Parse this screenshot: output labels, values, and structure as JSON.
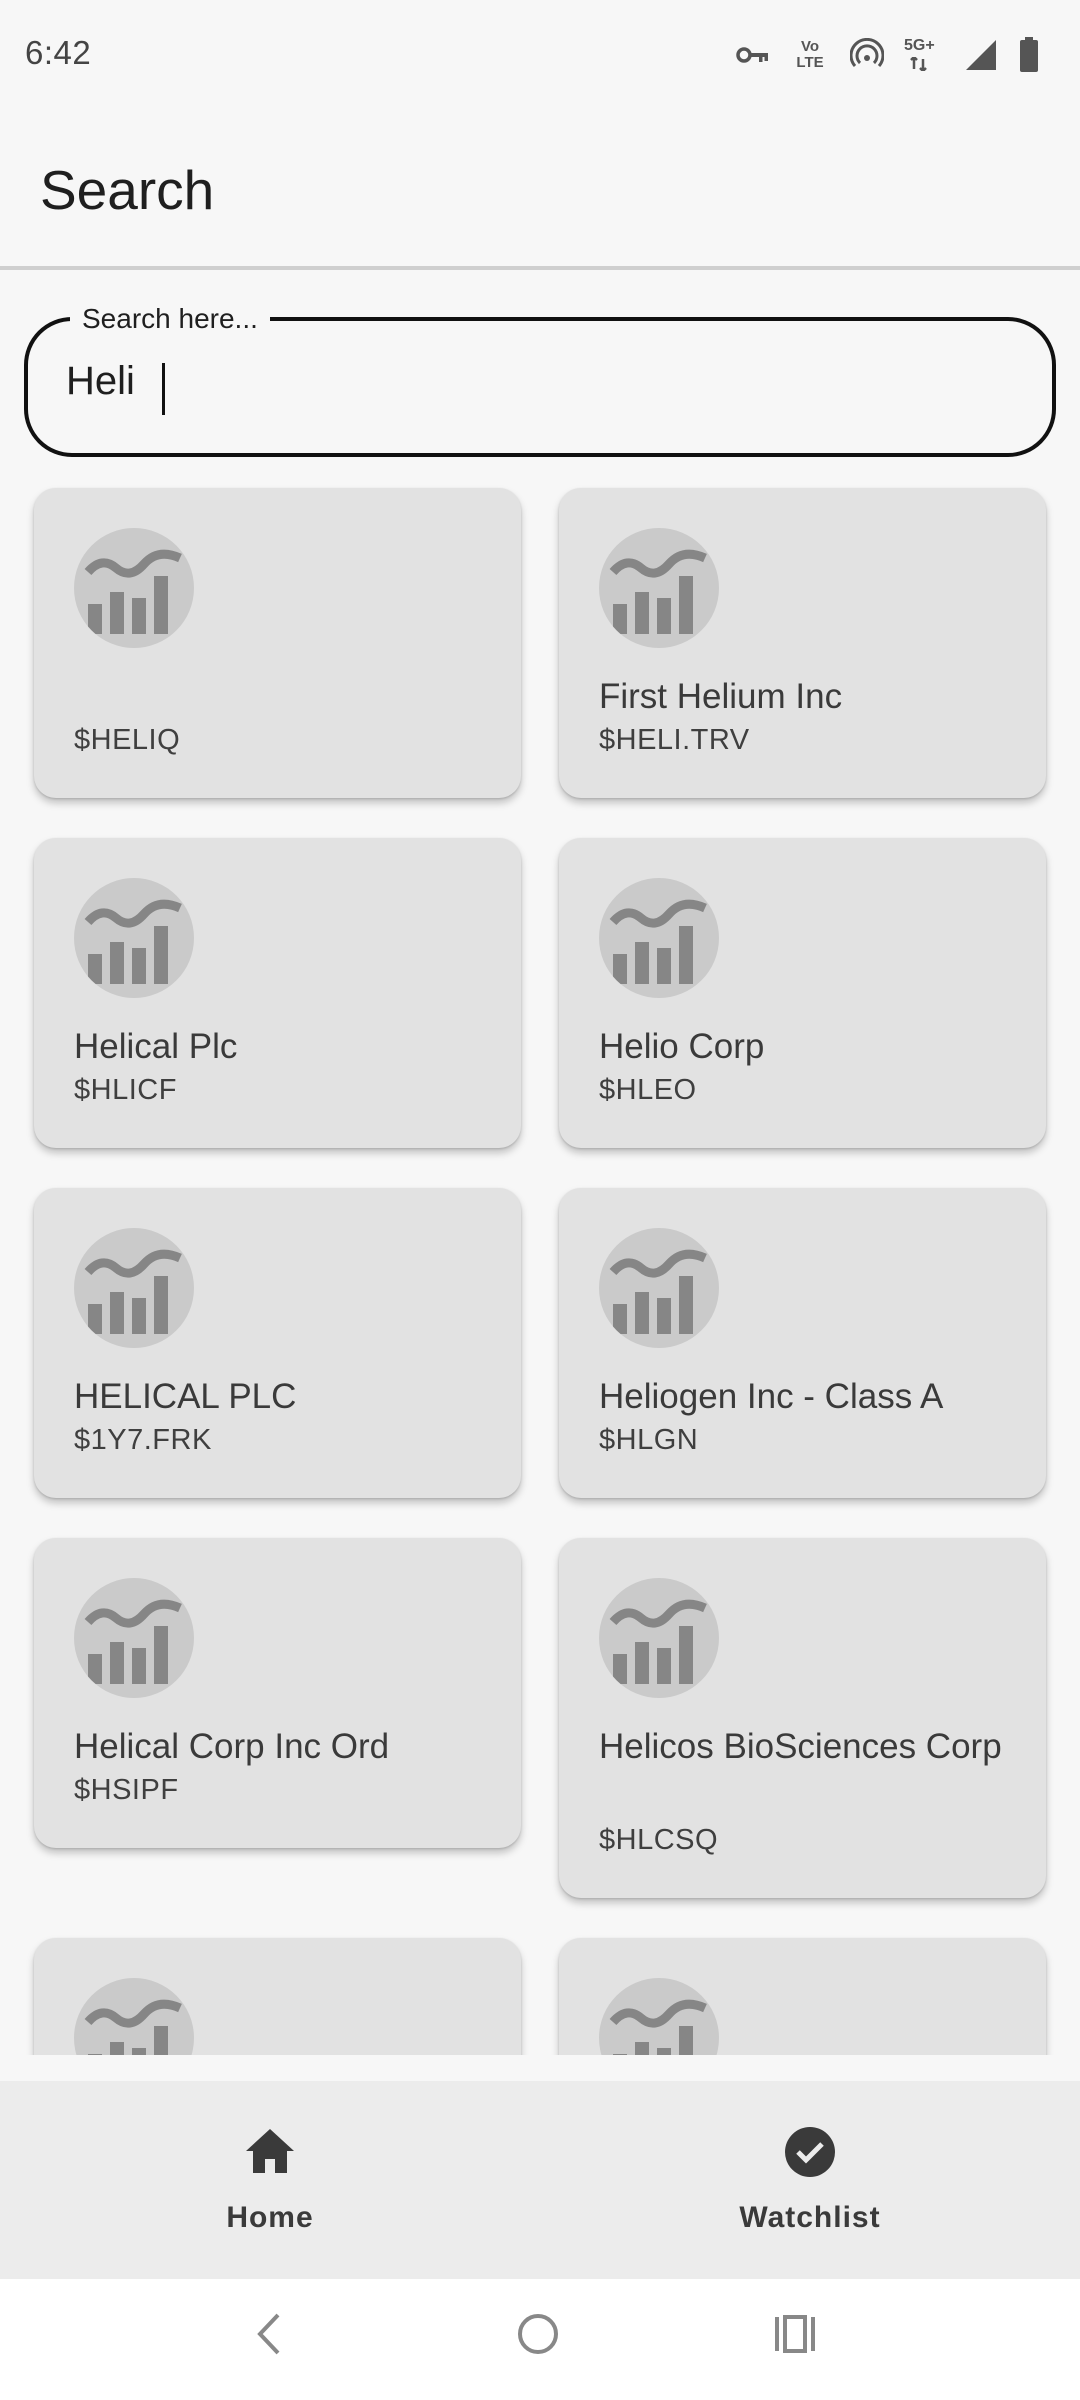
{
  "status_bar": {
    "time": "6:42",
    "volte_text": "Vo LTE",
    "network_text": "5G+"
  },
  "app_bar": {
    "title": "Search"
  },
  "search": {
    "label": "Search here...",
    "value": "Heli"
  },
  "results": [
    {
      "name": "",
      "ticker": "$HELIQ"
    },
    {
      "name": "First Helium Inc",
      "ticker": "$HELI.TRV"
    },
    {
      "name": "Helical Plc",
      "ticker": "$HLICF"
    },
    {
      "name": "Helio Corp",
      "ticker": "$HLEO"
    },
    {
      "name": "HELICAL PLC",
      "ticker": "$1Y7.FRK"
    },
    {
      "name": "Heliogen Inc - Class A",
      "ticker": "$HLGN"
    },
    {
      "name": "Helical Corp Inc Ord",
      "ticker": "$HSIPF"
    },
    {
      "name": "Helicos BioSciences Corp",
      "ticker": "$HLCSQ"
    }
  ],
  "result_icon": "chart-logo-icon",
  "bottom_nav": {
    "home_label": "Home",
    "watchlist_label": "Watchlist",
    "home_icon": "home-icon",
    "watchlist_icon": "check-circle-icon"
  },
  "system_nav": {
    "back_icon": "back-icon",
    "home_icon": "circle-home-icon",
    "recents_icon": "recents-icon"
  },
  "colors": {
    "background": "#f7f7f7",
    "card": "#e2e2e2",
    "nav_bar": "#ececec",
    "logo_circle": "#cacaca",
    "logo_chart": "#868686"
  }
}
